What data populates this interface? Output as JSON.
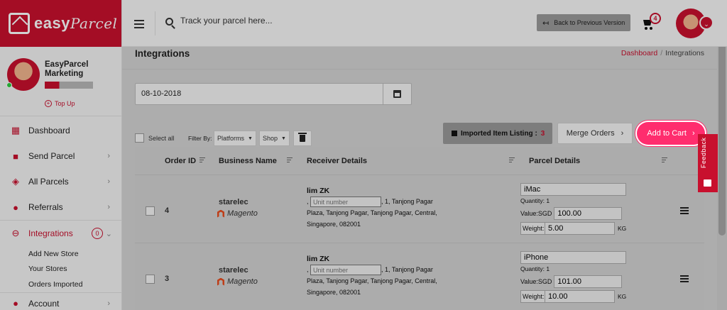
{
  "brand": {
    "name": "easy",
    "name_italic": "Parcel"
  },
  "user": {
    "name": "EasyParcel Marketing",
    "topup_label": "Top Up"
  },
  "sidebar": {
    "items": [
      {
        "label": "Dashboard",
        "icon": "dashboard-icon"
      },
      {
        "label": "Send Parcel",
        "icon": "truck-icon"
      },
      {
        "label": "All Parcels",
        "icon": "boxes-icon"
      },
      {
        "label": "Referrals",
        "icon": "users-icon"
      },
      {
        "label": "Integrations",
        "icon": "link-icon",
        "count": "0"
      }
    ],
    "subitems": [
      "Add New Store",
      "Your Stores",
      "Orders Imported"
    ],
    "account": {
      "label": "Account",
      "icon": "user-icon"
    }
  },
  "topbar": {
    "search_placeholder": "Track your parcel here...",
    "back_label": "Back to Previous Version",
    "cart_count": "4"
  },
  "page": {
    "title": "Integrations",
    "breadcrumb": {
      "home": "Dashboard",
      "current": "Integrations"
    }
  },
  "date_filter": {
    "value": "08-10-2018"
  },
  "toolbar": {
    "select_all": "Select all",
    "filter_by": "Filter By:",
    "platforms": "Platforms",
    "shop": "Shop",
    "imported_label": "Imported Item Listing :",
    "imported_count": "3",
    "merge_label": "Merge Orders",
    "add_to_cart_label": "Add to Cart"
  },
  "table": {
    "headers": {
      "order_id": "Order ID",
      "business": "Business Name",
      "receiver": "Receiver Details",
      "parcel": "Parcel Details"
    },
    "rows": [
      {
        "order_id": "4",
        "business": "starelec",
        "platform": "Magento",
        "receiver_name": "lim ZK",
        "unit_placeholder": "Unit number",
        "address_a": ", 1, Tanjong Pagar",
        "address_b": "Plaza, Tanjong Pagar, Tanjong Pagar, Central,",
        "address_c": "Singapore, 082001",
        "item": "iMac",
        "quantity": "Quantity: 1",
        "value_label": "Value:SGD",
        "value": "100.00",
        "weight_label": "Weight:",
        "weight": "5.00",
        "weight_unit": "KG"
      },
      {
        "order_id": "3",
        "business": "starelec",
        "platform": "Magento",
        "receiver_name": "lim ZK",
        "unit_placeholder": "Unit number",
        "address_a": ", 1, Tanjong Pagar",
        "address_b": "Plaza, Tanjong Pagar, Tanjong Pagar, Central,",
        "address_c": "Singapore, 082001",
        "item": "iPhone",
        "quantity": "Quantity: 1",
        "value_label": "Value:SGD",
        "value": "101.00",
        "weight_label": "Weight:",
        "weight": "10.00",
        "weight_unit": "KG"
      }
    ]
  },
  "feedback_label": "Feedback",
  "colors": {
    "brand_red": "#c8102e",
    "highlight_pink": "#ff2d6e"
  }
}
